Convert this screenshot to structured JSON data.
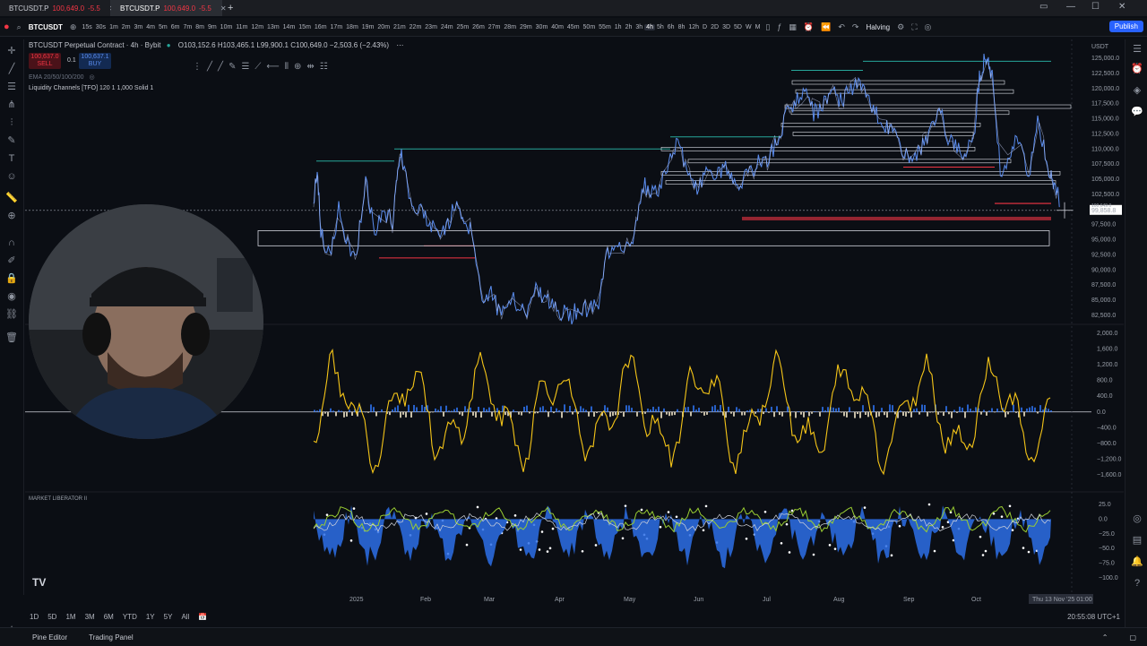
{
  "browser": {
    "tabs": [
      {
        "label": "BTCUSDT.P",
        "price": "100,649.0",
        "change": "-5.5",
        "active": false
      },
      {
        "label": "BTCUSDT.P",
        "price": "100,649.0",
        "change": "-5.5",
        "active": true
      }
    ],
    "new_tab": "+"
  },
  "toolbar": {
    "symbol": "BTCUSDT",
    "timeframes": [
      "15s",
      "30s",
      "1m",
      "2m",
      "3m",
      "4m",
      "5m",
      "6m",
      "7m",
      "8m",
      "9m",
      "10m",
      "11m",
      "12m",
      "13m",
      "14m",
      "15m",
      "16m",
      "17m",
      "18m",
      "19m",
      "20m",
      "21m",
      "22m",
      "23m",
      "24m",
      "25m",
      "26m",
      "27m",
      "28m",
      "29m",
      "30m",
      "40m",
      "45m",
      "50m",
      "55m",
      "1h",
      "2h",
      "3h",
      "4h",
      "5h",
      "6h",
      "8h",
      "12h",
      "D",
      "2D",
      "3D",
      "5D",
      "W",
      "M"
    ],
    "selected_timeframe": "4h",
    "halving": "Halving",
    "publish": "Publish"
  },
  "legend": {
    "title": "BTCUSDT Perpetual Contract · 4h · Bybit",
    "ohlc": "O103,152.6 H103,465.1 L99,900.1 C100,649.0 −2,503.6 (−2.43%)",
    "sell_price": "100,637.0",
    "sell_label": "SELL",
    "qty": "0.1",
    "buy_price": "100,637.1",
    "buy_label": "BUY",
    "ema": "EMA 20/50/100/200",
    "indicator": "Liquidity Channels [TFO] 120 1 1,000 Solid 1",
    "panel3_label": "MARKET LIBERATOR II"
  },
  "price_axis": {
    "currency": "USDT",
    "labels": [
      "125,000.0",
      "122,500.0",
      "120,000.0",
      "117,500.0",
      "115,000.0",
      "112,500.0",
      "110,000.0",
      "107,500.0",
      "105,000.0",
      "102,500.0",
      "97,500.0",
      "95,000.0",
      "92,500.0",
      "90,000.0",
      "87,500.0",
      "85,000.0",
      "82,500.0"
    ],
    "current": "99,858.8",
    "current_small": "100,649.0"
  },
  "osc_axis": {
    "labels": [
      "2,000.0",
      "1,600.0",
      "1,200.0",
      "800.0",
      "400.0",
      "0.0",
      "−400.0",
      "−800.0",
      "−1,200.0",
      "−1,600.0"
    ]
  },
  "osc2_axis": {
    "labels": [
      "25.0",
      "0.0",
      "−25.0",
      "−50.0",
      "−75.0",
      "−100.0"
    ]
  },
  "time_axis": {
    "labels": [
      "2025",
      "Feb",
      "Mar",
      "Apr",
      "May",
      "Jun",
      "Jul",
      "Aug",
      "Sep",
      "Oct"
    ],
    "cursor": "Thu 13 Nov '25  01:00"
  },
  "range_bar": {
    "ranges": [
      "1D",
      "5D",
      "1M",
      "3M",
      "6M",
      "YTD",
      "1Y",
      "5Y",
      "All"
    ],
    "clock": "20:55:08 UTC+1"
  },
  "bottom_tabs": [
    "Pine Editor",
    "Trading Panel"
  ],
  "colors": {
    "price_line": "#5b8def",
    "accent": "#2962ff",
    "up": "#26a69a",
    "down": "#f23645",
    "osc_yellow": "#f5c518",
    "osc_blue": "#2d6fe8",
    "osc_green": "#9acd32"
  },
  "icons": {
    "webcam": "streamer-webcam",
    "logo": "tradingview-logo"
  }
}
